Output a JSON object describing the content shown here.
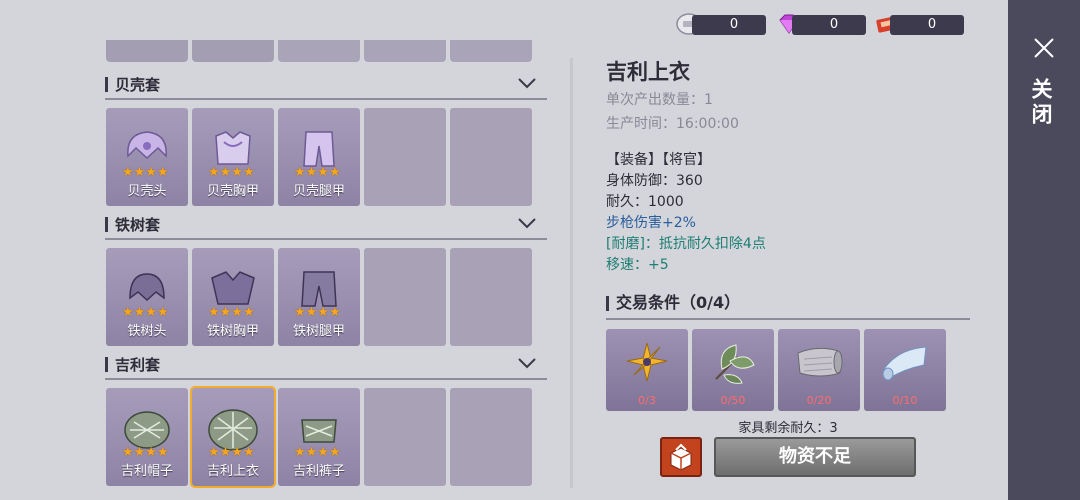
{
  "currencies": [
    {
      "icon": "silver-coin-icon",
      "value": "0"
    },
    {
      "icon": "purple-gem-icon",
      "value": "0"
    },
    {
      "icon": "red-ticket-icon",
      "value": "0"
    }
  ],
  "close_label": "关闭",
  "sets": [
    {
      "name": "贝壳套",
      "items": [
        {
          "label": "贝壳头",
          "stars": "★★★★"
        },
        {
          "label": "贝壳胸甲",
          "stars": "★★★★"
        },
        {
          "label": "贝壳腿甲",
          "stars": "★★★★"
        }
      ]
    },
    {
      "name": "铁树套",
      "items": [
        {
          "label": "铁树头",
          "stars": "★★★★"
        },
        {
          "label": "铁树胸甲",
          "stars": "★★★★"
        },
        {
          "label": "铁树腿甲",
          "stars": "★★★★"
        }
      ]
    },
    {
      "name": "吉利套",
      "items": [
        {
          "label": "吉利帽子",
          "stars": "★★★★"
        },
        {
          "label": "吉利上衣",
          "stars": "★★★★"
        },
        {
          "label": "吉利裤子",
          "stars": "★★★★"
        }
      ]
    }
  ],
  "detail": {
    "title": "吉利上衣",
    "output_qty": "单次产出数量：1",
    "prod_time": "生产时间：16:00:00",
    "tags": "【装备】【将官】",
    "defense": "身体防御：360",
    "durability": "耐久：1000",
    "rifle_dmg": "步枪伤害+2%",
    "wear": "[耐磨]：抵抗耐久扣除4点",
    "speed": "移速：+5"
  },
  "trade": {
    "title": "交易条件（0/4）",
    "materials": [
      {
        "icon": "golden-flower-icon",
        "count": "0/3"
      },
      {
        "icon": "leaf-icon",
        "count": "0/50"
      },
      {
        "icon": "cloth-roll-icon",
        "count": "0/20"
      },
      {
        "icon": "blue-fabric-icon",
        "count": "0/10"
      }
    ],
    "remaining": "家具剩余耐久：3",
    "button": "物资不足"
  },
  "colors": {
    "accent_selected": "#f2ac2c",
    "red_count": "#ff6b6b",
    "blue_stat": "#2a5d9b",
    "teal_stat": "#1e7e74"
  }
}
